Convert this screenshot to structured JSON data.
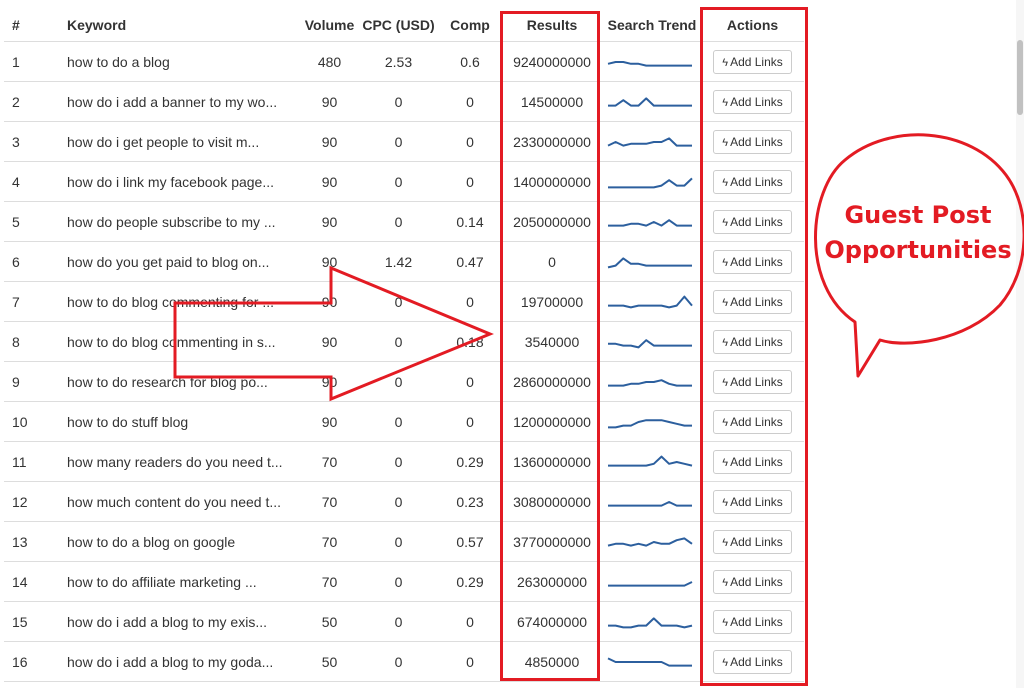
{
  "columns": {
    "num": "#",
    "keyword": "Keyword",
    "volume": "Volume",
    "cpc": "CPC (USD)",
    "comp": "Comp",
    "results": "Results",
    "trend": "Search Trend",
    "actions": "Actions"
  },
  "action_label": "Add Links",
  "rows": [
    {
      "num": "1",
      "keyword": "how to do a blog",
      "volume": "480",
      "cpc": "2.53",
      "comp": "0.6",
      "results": "9240000000",
      "trend": [
        4,
        5,
        5,
        4,
        4,
        3,
        3,
        3,
        3,
        3,
        3,
        3
      ]
    },
    {
      "num": "2",
      "keyword": "how do i add a banner to my wo...",
      "volume": "90",
      "cpc": "0",
      "comp": "0",
      "results": "14500000",
      "trend": [
        3,
        3,
        6,
        3,
        3,
        7,
        3,
        3,
        3,
        3,
        3,
        3
      ]
    },
    {
      "num": "3",
      "keyword": "how do i get people to visit m...",
      "volume": "90",
      "cpc": "0",
      "comp": "0",
      "results": "2330000000",
      "trend": [
        3,
        5,
        3,
        4,
        4,
        4,
        5,
        5,
        7,
        3,
        3,
        3
      ]
    },
    {
      "num": "4",
      "keyword": "how do i link my facebook page...",
      "volume": "90",
      "cpc": "0",
      "comp": "0",
      "results": "1400000000",
      "trend": [
        2,
        2,
        2,
        2,
        2,
        2,
        2,
        3,
        6,
        3,
        3,
        7
      ]
    },
    {
      "num": "5",
      "keyword": "how do people subscribe to my ...",
      "volume": "90",
      "cpc": "0",
      "comp": "0.14",
      "results": "2050000000",
      "trend": [
        3,
        3,
        3,
        4,
        4,
        3,
        5,
        3,
        6,
        3,
        3,
        3
      ]
    },
    {
      "num": "6",
      "keyword": "how do you get paid to blog on...",
      "volume": "90",
      "cpc": "1.42",
      "comp": "0.47",
      "results": "0",
      "trend": [
        2,
        3,
        7,
        4,
        4,
        3,
        3,
        3,
        3,
        3,
        3,
        3
      ]
    },
    {
      "num": "7",
      "keyword": "how to do blog commenting for ...",
      "volume": "90",
      "cpc": "0",
      "comp": "0",
      "results": "19700000",
      "trend": [
        3,
        3,
        3,
        2,
        3,
        3,
        3,
        3,
        2,
        3,
        8,
        3
      ]
    },
    {
      "num": "8",
      "keyword": "how to do blog commenting in s...",
      "volume": "90",
      "cpc": "0",
      "comp": "0.18",
      "results": "3540000",
      "trend": [
        4,
        4,
        3,
        3,
        2,
        6,
        3,
        3,
        3,
        3,
        3,
        3
      ]
    },
    {
      "num": "9",
      "keyword": "how to do research for blog po...",
      "volume": "90",
      "cpc": "0",
      "comp": "0",
      "results": "2860000000",
      "trend": [
        3,
        3,
        3,
        4,
        4,
        5,
        5,
        6,
        4,
        3,
        3,
        3
      ]
    },
    {
      "num": "10",
      "keyword": "how to do stuff blog",
      "volume": "90",
      "cpc": "0",
      "comp": "0",
      "results": "1200000000",
      "trend": [
        2,
        2,
        3,
        3,
        5,
        6,
        6,
        6,
        5,
        4,
        3,
        3
      ]
    },
    {
      "num": "11",
      "keyword": "how many readers do you need t...",
      "volume": "70",
      "cpc": "0",
      "comp": "0.29",
      "results": "1360000000",
      "trend": [
        3,
        3,
        3,
        3,
        3,
        3,
        4,
        8,
        4,
        5,
        4,
        3
      ]
    },
    {
      "num": "12",
      "keyword": "how much content do you need t...",
      "volume": "70",
      "cpc": "0",
      "comp": "0.23",
      "results": "3080000000",
      "trend": [
        3,
        3,
        3,
        3,
        3,
        3,
        3,
        3,
        5,
        3,
        3,
        3
      ]
    },
    {
      "num": "13",
      "keyword": "how to do a blog on google",
      "volume": "70",
      "cpc": "0",
      "comp": "0.57",
      "results": "3770000000",
      "trend": [
        3,
        4,
        4,
        3,
        4,
        3,
        5,
        4,
        4,
        6,
        7,
        4
      ]
    },
    {
      "num": "14",
      "keyword": "how to do affiliate marketing ...",
      "volume": "70",
      "cpc": "0",
      "comp": "0.29",
      "results": "263000000",
      "trend": [
        3,
        3,
        3,
        3,
        3,
        3,
        3,
        3,
        3,
        3,
        3,
        5
      ]
    },
    {
      "num": "15",
      "keyword": "how do i add a blog to my exis...",
      "volume": "50",
      "cpc": "0",
      "comp": "0",
      "results": "674000000",
      "trend": [
        3,
        3,
        2,
        2,
        3,
        3,
        7,
        3,
        3,
        3,
        2,
        3
      ]
    },
    {
      "num": "16",
      "keyword": "how do i add a blog to my goda...",
      "volume": "50",
      "cpc": "0",
      "comp": "0",
      "results": "4850000",
      "trend": [
        7,
        5,
        5,
        5,
        5,
        5,
        5,
        5,
        3,
        3,
        3,
        3
      ]
    }
  ],
  "annotation": {
    "callout_line1": "Guest Post",
    "callout_line2": "Opportunities",
    "color": "#e31b23"
  },
  "trend_color": "#2c5f9e"
}
